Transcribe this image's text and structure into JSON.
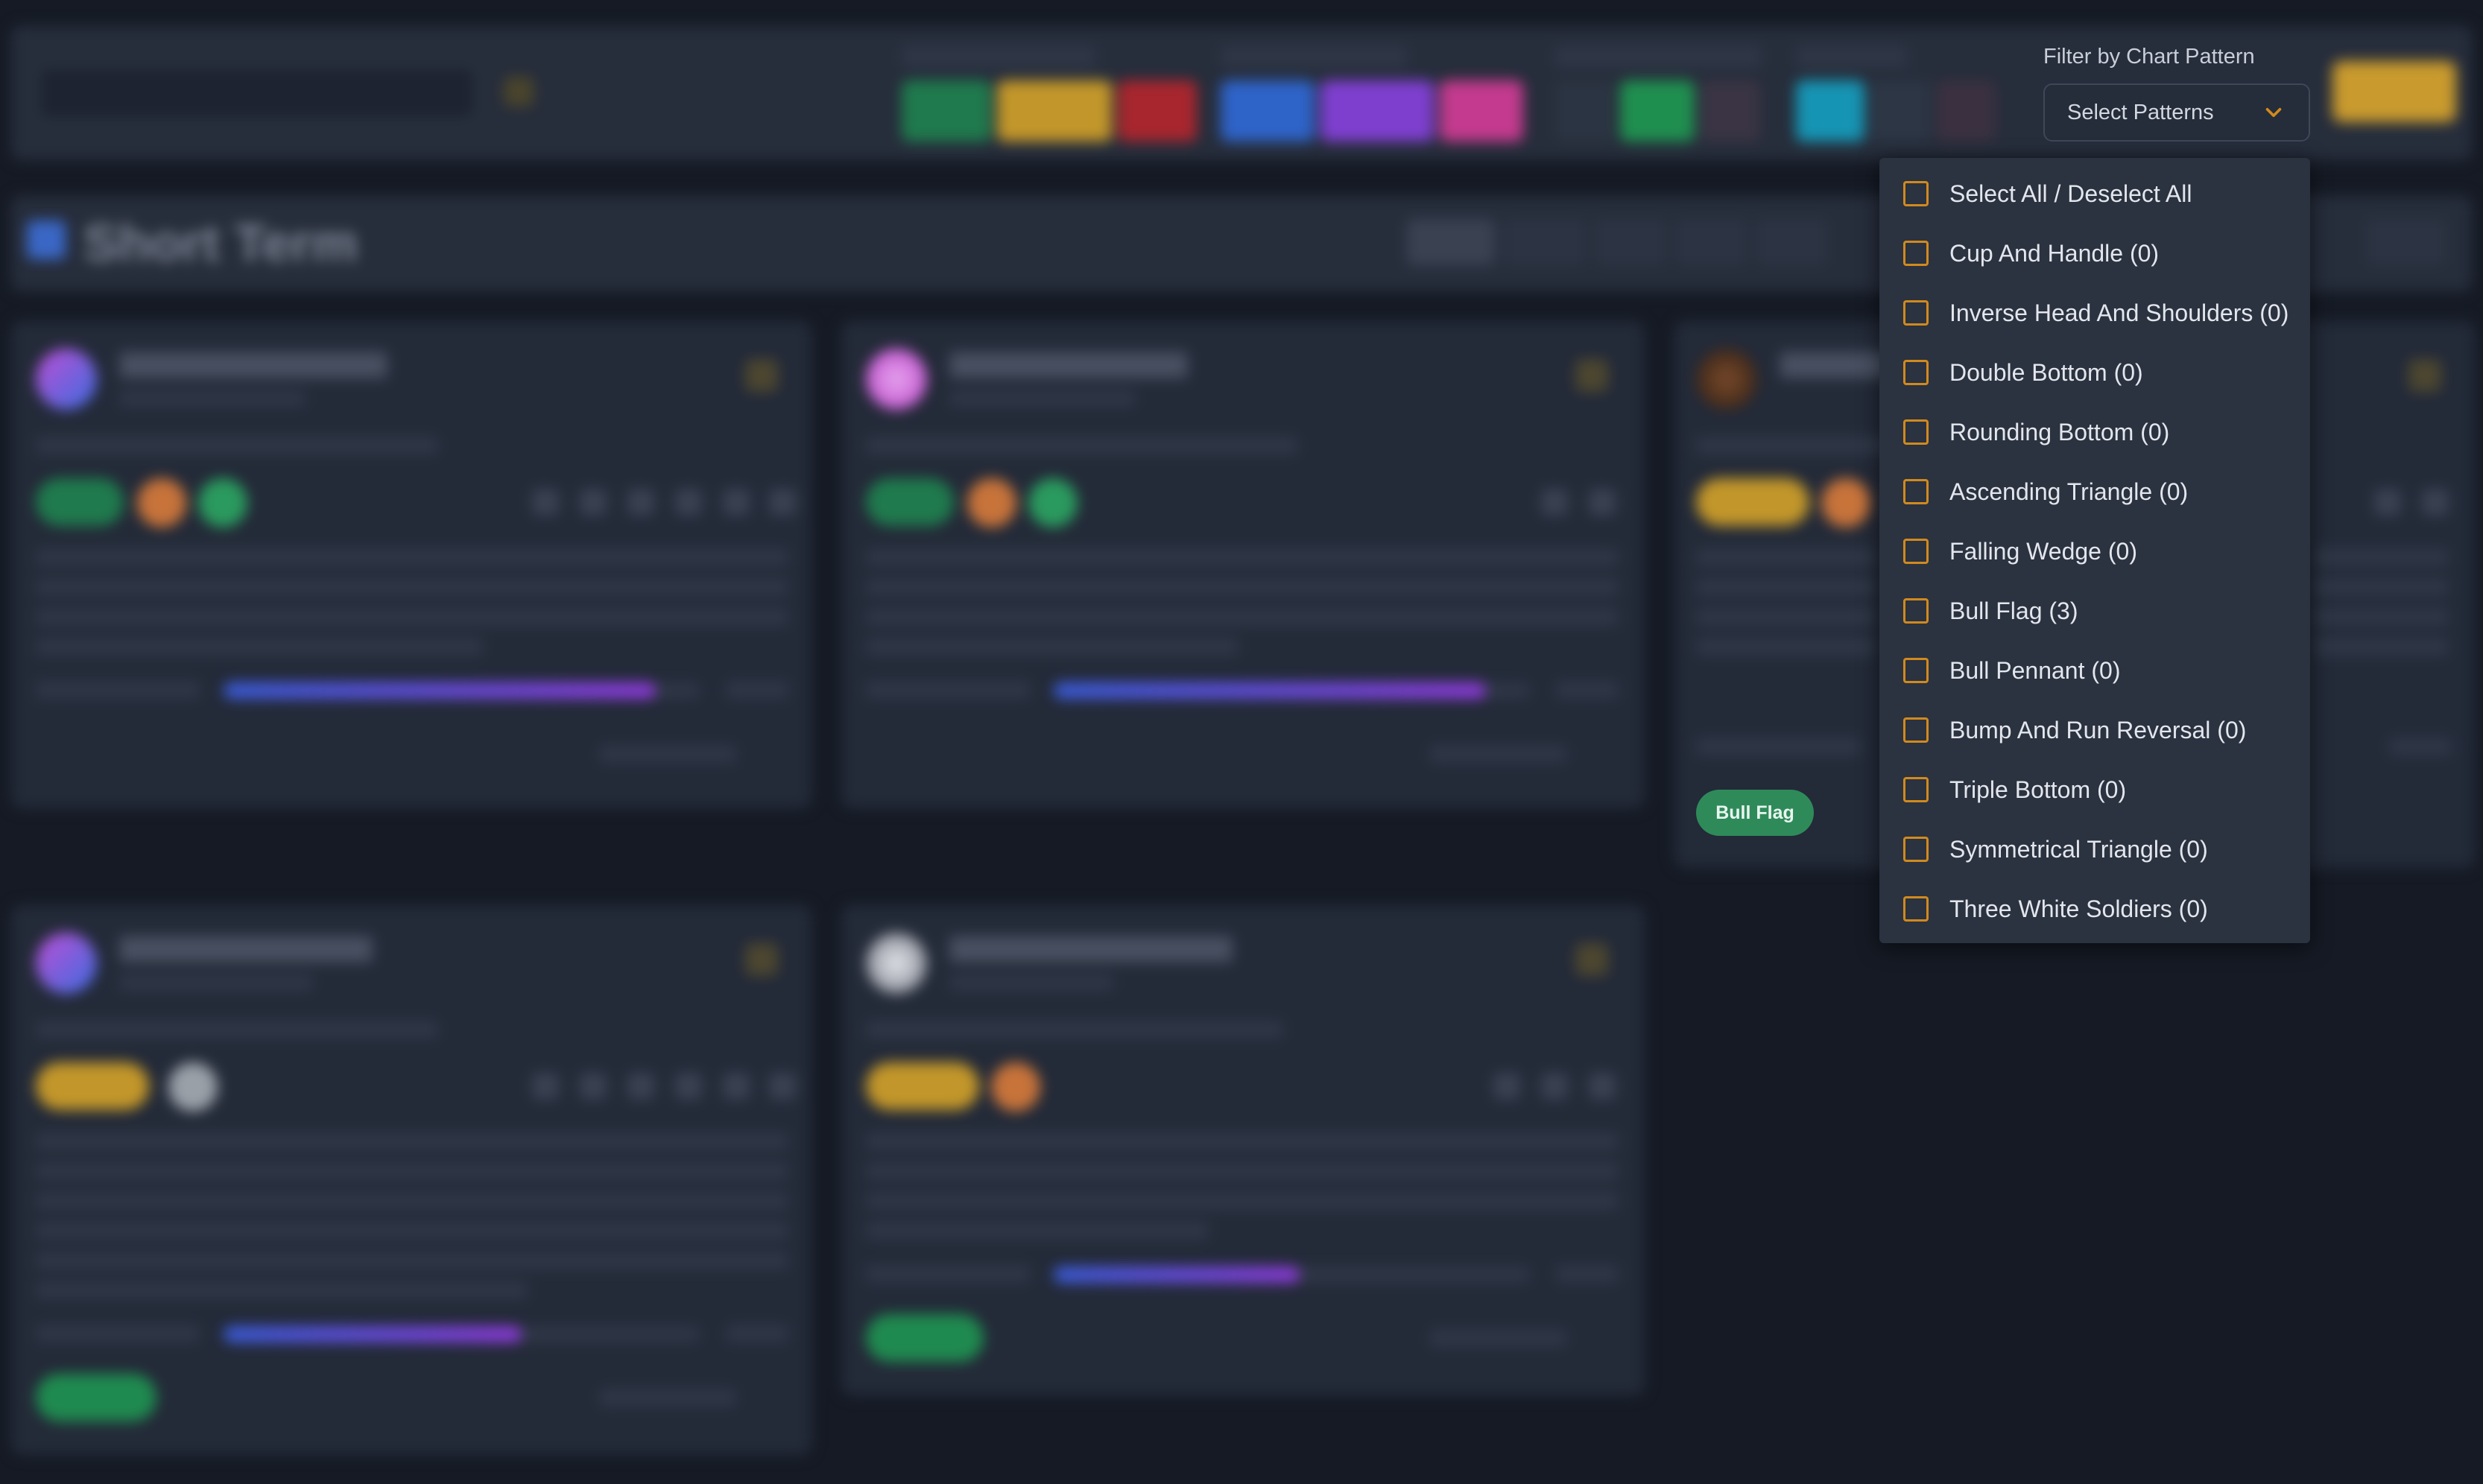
{
  "filter": {
    "label": "Filter by Chart Pattern",
    "select_placeholder": "Select Patterns",
    "options": [
      {
        "label": "Select All / Deselect All",
        "checked": false
      },
      {
        "label": "Cup And Handle (0)",
        "checked": false
      },
      {
        "label": "Inverse Head And Shoulders (0)",
        "checked": false
      },
      {
        "label": "Double Bottom (0)",
        "checked": false
      },
      {
        "label": "Rounding Bottom (0)",
        "checked": false
      },
      {
        "label": "Ascending Triangle (0)",
        "checked": false
      },
      {
        "label": "Falling Wedge (0)",
        "checked": false
      },
      {
        "label": "Bull Flag (3)",
        "checked": false
      },
      {
        "label": "Bull Pennant (0)",
        "checked": false
      },
      {
        "label": "Bump And Run Reversal (0)",
        "checked": false
      },
      {
        "label": "Triple Bottom (0)",
        "checked": false
      },
      {
        "label": "Symmetrical Triangle (0)",
        "checked": false
      },
      {
        "label": "Three White Soldiers (0)",
        "checked": false
      }
    ]
  },
  "background": {
    "section_title": "Short Term",
    "pattern_badge": "Bull Flag"
  },
  "colors": {
    "accent": "#d08a1e",
    "badge_green": "#2f8a5a",
    "panel": "#2b3240",
    "page_bg": "#151a24"
  }
}
